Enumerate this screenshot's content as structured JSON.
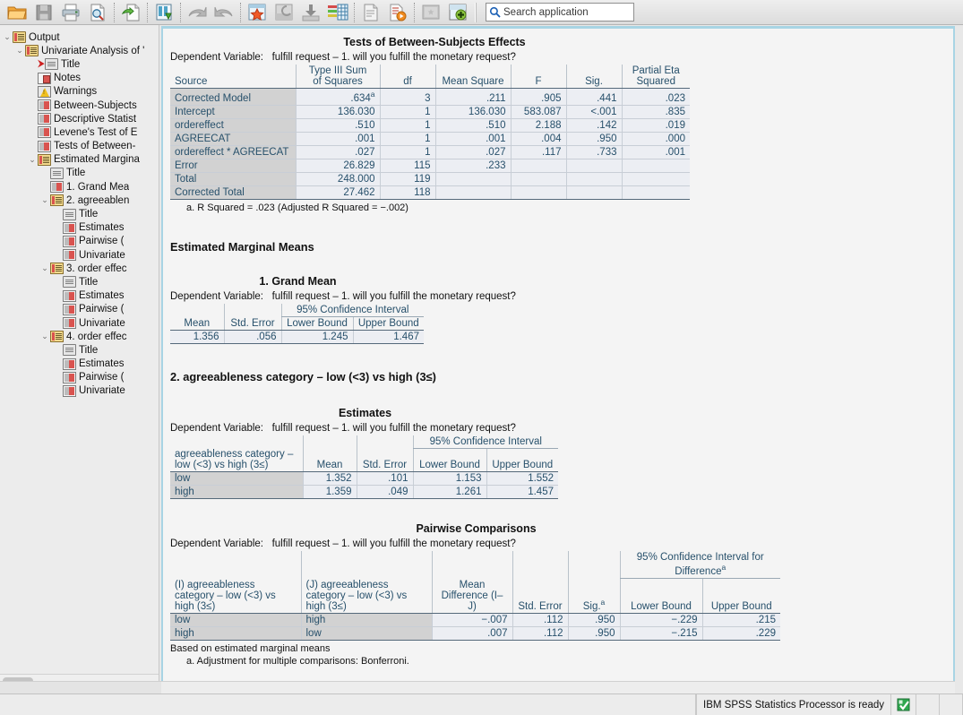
{
  "toolbar": {
    "icons": [
      {
        "name": "open-file-icon",
        "glyph": "folder"
      },
      {
        "name": "save-icon",
        "glyph": "floppy"
      },
      {
        "name": "print-icon",
        "glyph": "printer"
      },
      {
        "name": "print-preview-icon",
        "glyph": "preview"
      },
      {
        "name": "recall-dialog-icon",
        "glyph": "recall"
      },
      {
        "name": "export-icon",
        "glyph": "export"
      },
      {
        "name": "undo-icon",
        "glyph": "undo"
      },
      {
        "name": "redo-icon",
        "glyph": "redo"
      },
      {
        "name": "goto-case-icon",
        "glyph": "star-grid"
      },
      {
        "name": "goto-variable-icon",
        "glyph": "var-grid"
      },
      {
        "name": "insert-icon",
        "glyph": "insert-down"
      },
      {
        "name": "variables-icon",
        "glyph": "variables"
      },
      {
        "name": "insert-text-icon",
        "glyph": "text-doc"
      },
      {
        "name": "run-script-icon",
        "glyph": "run-doc"
      },
      {
        "name": "select-last-output-icon",
        "glyph": "last-output"
      },
      {
        "name": "add-icon",
        "glyph": "add-plus"
      }
    ],
    "search": {
      "placeholder": "Search application",
      "value": "",
      "icon": "search-icon"
    }
  },
  "sidebar": {
    "items": [
      {
        "label": "Output",
        "depth": 0,
        "twisty": "open",
        "icon": "output-icon",
        "marker": ""
      },
      {
        "label": "Univariate Analysis of '",
        "depth": 1,
        "twisty": "open",
        "icon": "output-icon",
        "marker": ""
      },
      {
        "label": "Title",
        "depth": 2,
        "twisty": "",
        "icon": "title-icon",
        "marker": "→"
      },
      {
        "label": "Notes",
        "depth": 2,
        "twisty": "",
        "icon": "notes-icon",
        "marker": ""
      },
      {
        "label": "Warnings",
        "depth": 2,
        "twisty": "",
        "icon": "warnings-icon",
        "marker": ""
      },
      {
        "label": "Between-Subjects",
        "depth": 2,
        "twisty": "",
        "icon": "table-icon",
        "marker": ""
      },
      {
        "label": "Descriptive Statist",
        "depth": 2,
        "twisty": "",
        "icon": "table-icon",
        "marker": ""
      },
      {
        "label": "Levene's Test of E",
        "depth": 2,
        "twisty": "",
        "icon": "table-icon",
        "marker": ""
      },
      {
        "label": "Tests of Between-",
        "depth": 2,
        "twisty": "",
        "icon": "table-icon",
        "marker": ""
      },
      {
        "label": "Estimated Margina",
        "depth": 2,
        "twisty": "open",
        "icon": "emm-icon",
        "marker": ""
      },
      {
        "label": "Title",
        "depth": 3,
        "twisty": "",
        "icon": "title-icon",
        "marker": ""
      },
      {
        "label": "1. Grand Mea",
        "depth": 3,
        "twisty": "",
        "icon": "table-icon",
        "marker": ""
      },
      {
        "label": "2. agreeablen",
        "depth": 3,
        "twisty": "open",
        "icon": "emm-icon",
        "marker": ""
      },
      {
        "label": "Title",
        "depth": 4,
        "twisty": "",
        "icon": "title-icon",
        "marker": ""
      },
      {
        "label": "Estimates",
        "depth": 4,
        "twisty": "",
        "icon": "table-icon",
        "marker": ""
      },
      {
        "label": "Pairwise (",
        "depth": 4,
        "twisty": "",
        "icon": "table-icon",
        "marker": ""
      },
      {
        "label": "Univariate",
        "depth": 4,
        "twisty": "",
        "icon": "table-icon",
        "marker": ""
      },
      {
        "label": "3. order effec",
        "depth": 3,
        "twisty": "open",
        "icon": "emm-icon",
        "marker": ""
      },
      {
        "label": "Title",
        "depth": 4,
        "twisty": "",
        "icon": "title-icon",
        "marker": ""
      },
      {
        "label": "Estimates",
        "depth": 4,
        "twisty": "",
        "icon": "table-icon",
        "marker": ""
      },
      {
        "label": "Pairwise (",
        "depth": 4,
        "twisty": "",
        "icon": "table-icon",
        "marker": ""
      },
      {
        "label": "Univariate",
        "depth": 4,
        "twisty": "",
        "icon": "table-icon",
        "marker": ""
      },
      {
        "label": "4. order effec",
        "depth": 3,
        "twisty": "open",
        "icon": "emm-icon",
        "marker": ""
      },
      {
        "label": "Title",
        "depth": 4,
        "twisty": "",
        "icon": "title-icon",
        "marker": ""
      },
      {
        "label": "Estimates",
        "depth": 4,
        "twisty": "",
        "icon": "table-icon",
        "marker": ""
      },
      {
        "label": "Pairwise (",
        "depth": 4,
        "twisty": "",
        "icon": "table-icon",
        "marker": ""
      },
      {
        "label": "Univariate",
        "depth": 4,
        "twisty": "",
        "icon": "table-icon",
        "marker": ""
      }
    ]
  },
  "output": {
    "dependent_variable_label": "Dependent Variable:",
    "dependent_variable_value": "fulfill request – 1. will you fulfill the monetary request?",
    "anova": {
      "title": "Tests of Between-Subjects Effects",
      "headers": [
        "Source",
        "Type III Sum\nof Squares",
        "df",
        "Mean Square",
        "F",
        "Sig.",
        "Partial Eta\nSquared"
      ],
      "header_source": "Source",
      "header_ss_l1": "Type III Sum",
      "header_ss_l2": "of Squares",
      "header_df": "df",
      "header_ms": "Mean Square",
      "header_f": "F",
      "header_sig": "Sig.",
      "header_eta_l1": "Partial Eta",
      "header_eta_l2": "Squared",
      "rows": [
        {
          "source": "Corrected Model",
          "ss": ".634",
          "ss_sup": "a",
          "df": "3",
          "ms": ".211",
          "f": ".905",
          "sig": ".441",
          "eta": ".023"
        },
        {
          "source": "Intercept",
          "ss": "136.030",
          "ss_sup": "",
          "df": "1",
          "ms": "136.030",
          "f": "583.087",
          "sig": "<.001",
          "eta": ".835"
        },
        {
          "source": "ordereffect",
          "ss": ".510",
          "ss_sup": "",
          "df": "1",
          "ms": ".510",
          "f": "2.188",
          "sig": ".142",
          "eta": ".019"
        },
        {
          "source": "AGREECAT",
          "ss": ".001",
          "ss_sup": "",
          "df": "1",
          "ms": ".001",
          "f": ".004",
          "sig": ".950",
          "eta": ".000"
        },
        {
          "source": "ordereffect * AGREECAT",
          "ss": ".027",
          "ss_sup": "",
          "df": "1",
          "ms": ".027",
          "f": ".117",
          "sig": ".733",
          "eta": ".001"
        },
        {
          "source": "Error",
          "ss": "26.829",
          "ss_sup": "",
          "df": "115",
          "ms": ".233",
          "f": "",
          "sig": "",
          "eta": ""
        },
        {
          "source": "Total",
          "ss": "248.000",
          "ss_sup": "",
          "df": "119",
          "ms": "",
          "f": "",
          "sig": "",
          "eta": ""
        },
        {
          "source": "Corrected Total",
          "ss": "27.462",
          "ss_sup": "",
          "df": "118",
          "ms": "",
          "f": "",
          "sig": "",
          "eta": ""
        }
      ],
      "footnote": "a. R Squared = .023 (Adjusted R Squared = −.002)"
    },
    "emm_heading": "Estimated Marginal Means",
    "grand_mean": {
      "title": "1. Grand Mean",
      "ci_header": "95% Confidence Interval",
      "header_mean": "Mean",
      "header_se": "Std. Error",
      "header_lower": "Lower Bound",
      "header_upper": "Upper Bound",
      "row": {
        "mean": "1.356",
        "se": ".056",
        "lower": "1.245",
        "upper": "1.467"
      }
    },
    "section2_heading": "2. agreeableness category – low (<3) vs high (3≤)",
    "estimates": {
      "title": "Estimates",
      "header_factor_l1": "agreeableness category –",
      "header_factor_l2": "low (<3) vs high (3≤)",
      "ci_header": "95% Confidence Interval",
      "header_mean": "Mean",
      "header_se": "Std. Error",
      "header_lower": "Lower Bound",
      "header_upper": "Upper Bound",
      "rows": [
        {
          "factor": "low",
          "mean": "1.352",
          "se": ".101",
          "lower": "1.153",
          "upper": "1.552"
        },
        {
          "factor": "high",
          "mean": "1.359",
          "se": ".049",
          "lower": "1.261",
          "upper": "1.457"
        }
      ]
    },
    "pairwise": {
      "title": "Pairwise Comparisons",
      "header_i_l1": "(I) agreeableness",
      "header_i_l2": "category – low (<3) vs",
      "header_i_l3": "high (3≤)",
      "header_j_l1": "(J) agreeableness",
      "header_j_l2": "category – low (<3) vs",
      "header_j_l3": "high (3≤)",
      "header_md_l1": "Mean",
      "header_md_l2": "Difference (I–",
      "header_md_l3": "J)",
      "header_se": "Std. Error",
      "header_sig": "Sig.",
      "header_sig_sup": "a",
      "ci_header_l1": "95% Confidence Interval for",
      "ci_header_l2": "Difference",
      "ci_header_sup": "a",
      "header_lower": "Lower Bound",
      "header_upper": "Upper Bound",
      "rows": [
        {
          "i": "low",
          "j": "high",
          "md": "−.007",
          "se": ".112",
          "sig": ".950",
          "lower": "−.229",
          "upper": ".215"
        },
        {
          "i": "high",
          "j": "low",
          "md": ".007",
          "se": ".112",
          "sig": ".950",
          "lower": "−.215",
          "upper": ".229"
        }
      ],
      "note": "Based on estimated marginal means",
      "footnote": "a. Adjustment for multiple comparisons: Bonferroni."
    }
  },
  "statusbar": {
    "message": "IBM SPSS Statistics Processor is ready",
    "icon": "processor-ready-icon"
  },
  "colors": {
    "spss_text_blue": "#27506b",
    "row_header_gray": "#d2d2d2",
    "cell_bg": "#eceef3",
    "pane_border": "#a8d4e4"
  }
}
